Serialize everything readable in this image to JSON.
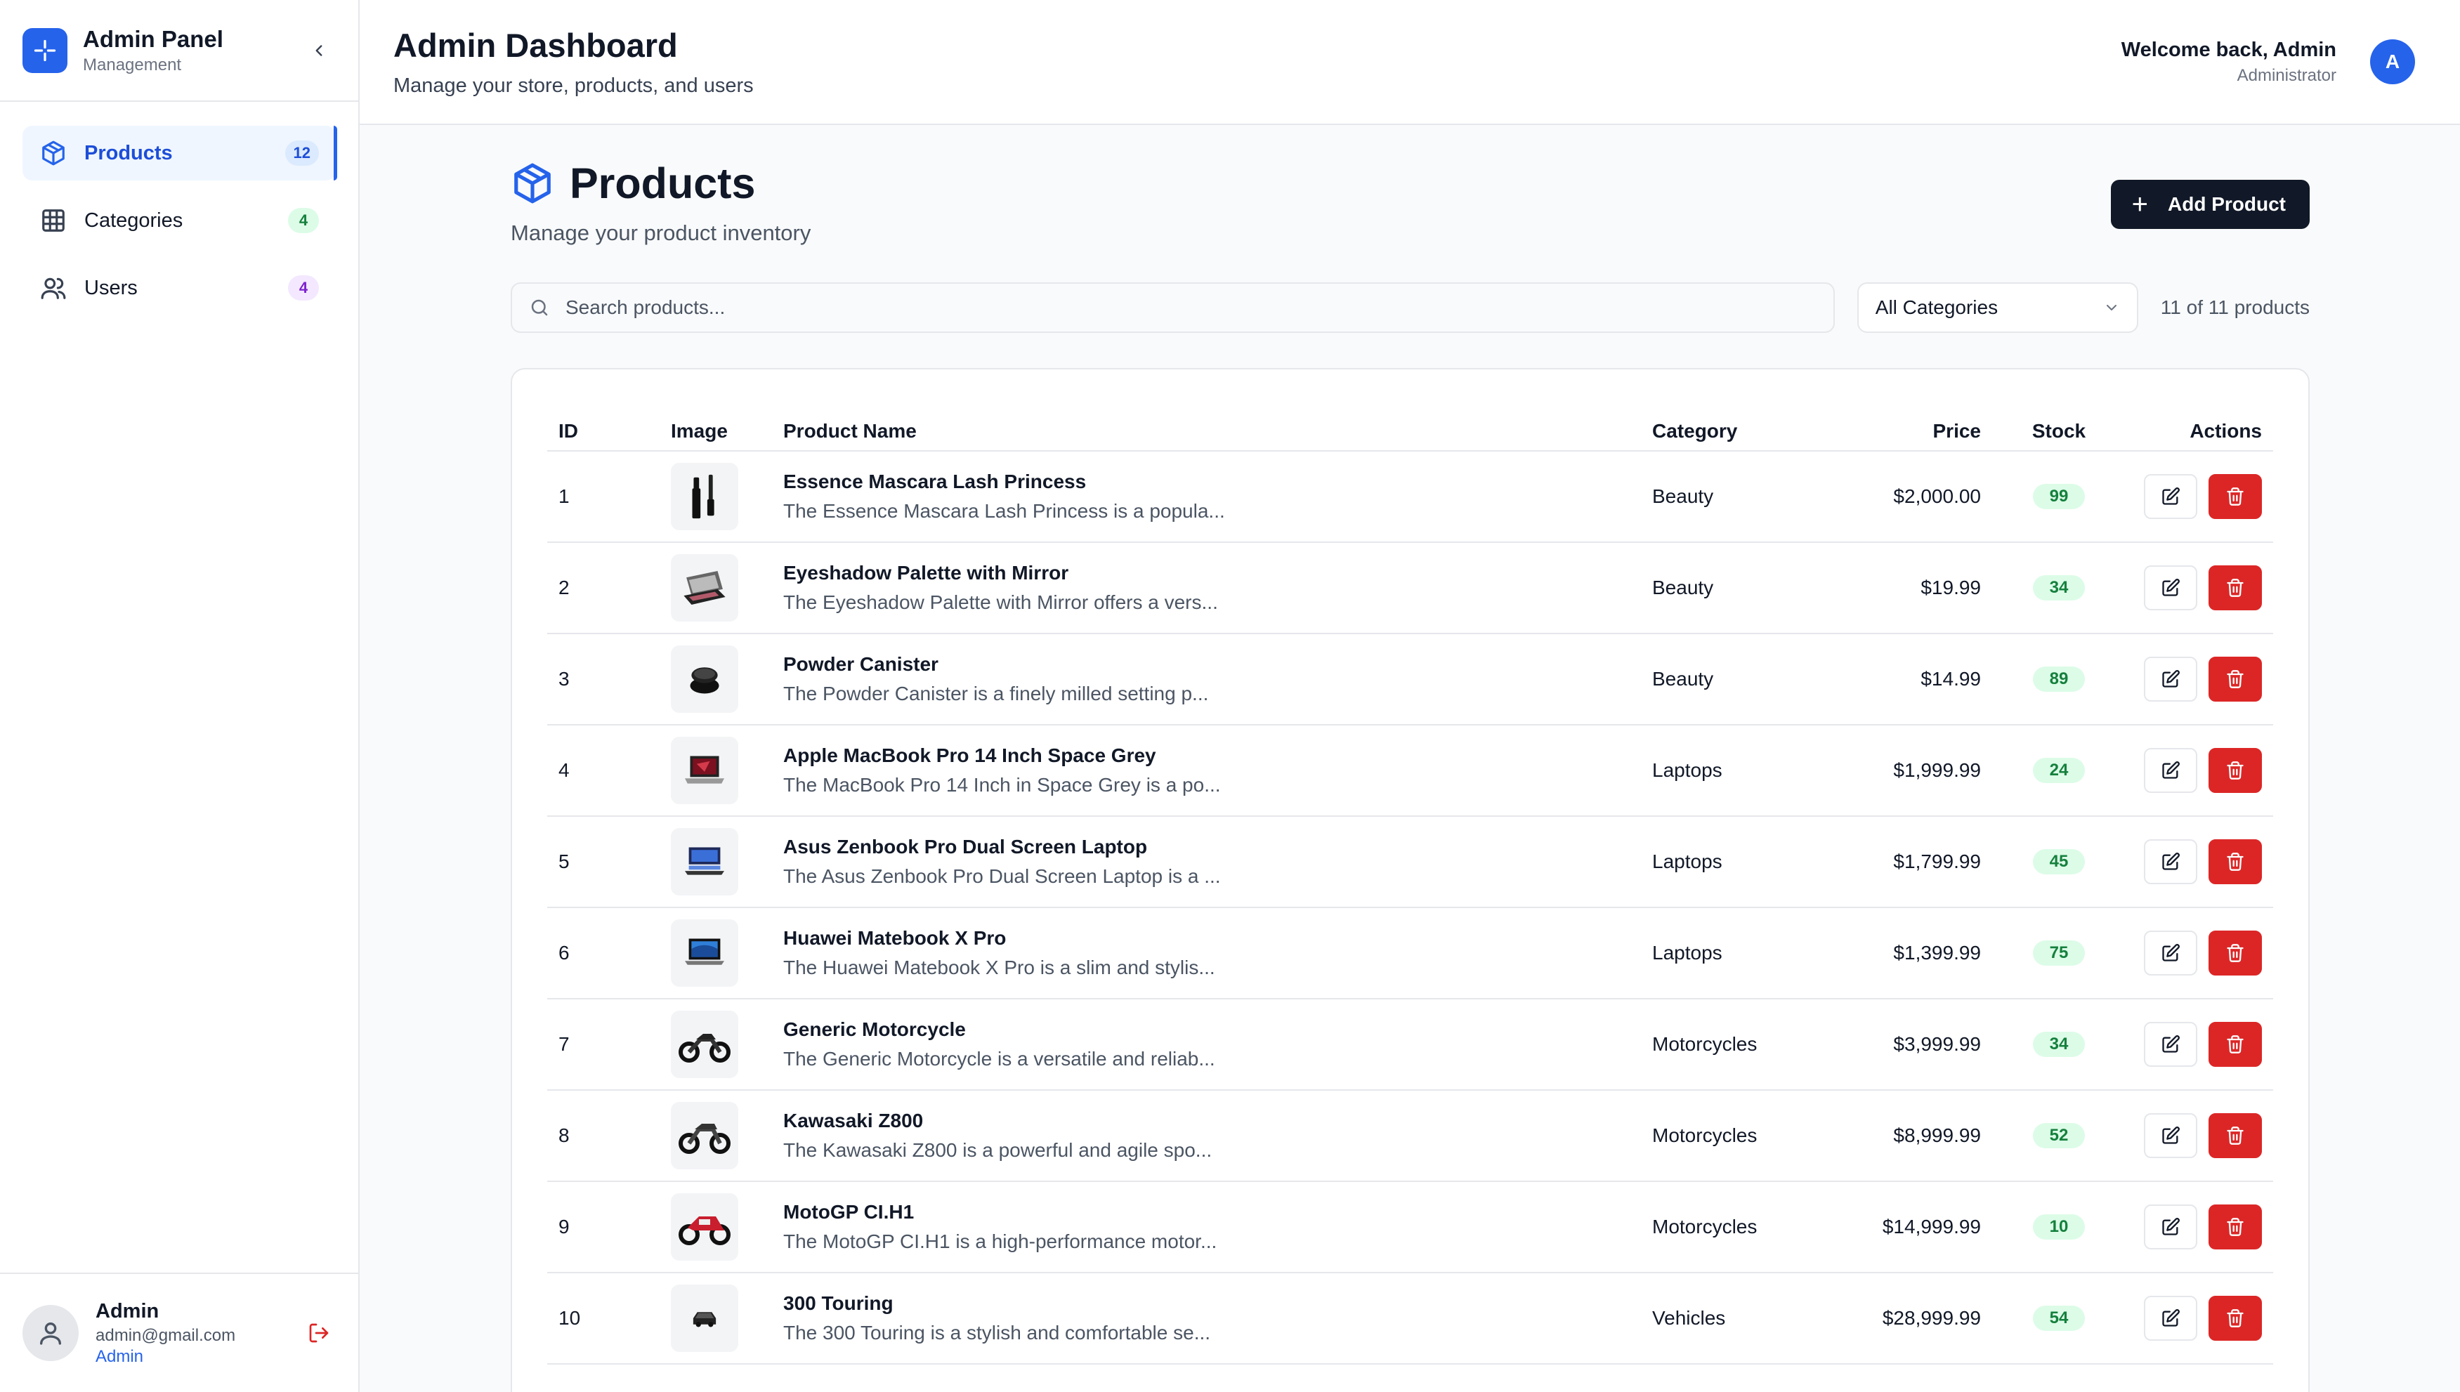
{
  "sidebar": {
    "brand_title": "Admin Panel",
    "brand_subtitle": "Management",
    "items": [
      {
        "label": "Products",
        "count": "12"
      },
      {
        "label": "Categories",
        "count": "4"
      },
      {
        "label": "Users",
        "count": "4"
      }
    ],
    "user": {
      "name": "Admin",
      "email": "admin@gmail.com",
      "role": "Admin"
    }
  },
  "header": {
    "title": "Admin Dashboard",
    "subtitle": "Manage your store, products, and users",
    "welcome": "Welcome back, Admin",
    "role": "Administrator",
    "avatar_initial": "A"
  },
  "products": {
    "title": "Products",
    "subtitle": "Manage your product inventory",
    "add_label": "Add Product",
    "search_placeholder": "Search products...",
    "category_filter": "All Categories",
    "count_text": "11 of 11 products",
    "columns": {
      "id": "ID",
      "image": "Image",
      "name": "Product Name",
      "category": "Category",
      "price": "Price",
      "stock": "Stock",
      "actions": "Actions"
    },
    "rows": [
      {
        "id": "1",
        "name": "Essence Mascara Lash Princess",
        "desc": "The Essence Mascara Lash Princess is a popula...",
        "category": "Beauty",
        "price": "$2,000.00",
        "stock": "99",
        "thumb": "mascara"
      },
      {
        "id": "2",
        "name": "Eyeshadow Palette with Mirror",
        "desc": "The Eyeshadow Palette with Mirror offers a vers...",
        "category": "Beauty",
        "price": "$19.99",
        "stock": "34",
        "thumb": "palette"
      },
      {
        "id": "3",
        "name": "Powder Canister",
        "desc": "The Powder Canister is a finely milled setting p...",
        "category": "Beauty",
        "price": "$14.99",
        "stock": "89",
        "thumb": "powder"
      },
      {
        "id": "4",
        "name": "Apple MacBook Pro 14 Inch Space Grey",
        "desc": "The MacBook Pro 14 Inch in Space Grey is a po...",
        "category": "Laptops",
        "price": "$1,999.99",
        "stock": "24",
        "thumb": "laptop-red"
      },
      {
        "id": "5",
        "name": "Asus Zenbook Pro Dual Screen Laptop",
        "desc": "The Asus Zenbook Pro Dual Screen Laptop is a ...",
        "category": "Laptops",
        "price": "$1,799.99",
        "stock": "45",
        "thumb": "laptop-blue"
      },
      {
        "id": "6",
        "name": "Huawei Matebook X Pro",
        "desc": "The Huawei Matebook X Pro is a slim and stylis...",
        "category": "Laptops",
        "price": "$1,399.99",
        "stock": "75",
        "thumb": "laptop-sky"
      },
      {
        "id": "7",
        "name": "Generic Motorcycle",
        "desc": "The Generic Motorcycle is a versatile and reliab...",
        "category": "Motorcycles",
        "price": "$3,999.99",
        "stock": "34",
        "thumb": "moto-black"
      },
      {
        "id": "8",
        "name": "Kawasaki Z800",
        "desc": "The Kawasaki Z800 is a powerful and agile spo...",
        "category": "Motorcycles",
        "price": "$8,999.99",
        "stock": "52",
        "thumb": "moto-dark"
      },
      {
        "id": "9",
        "name": "MotoGP CI.H1",
        "desc": "The MotoGP CI.H1 is a high-performance motor...",
        "category": "Motorcycles",
        "price": "$14,999.99",
        "stock": "10",
        "thumb": "moto-red"
      },
      {
        "id": "10",
        "name": "300 Touring",
        "desc": "The 300 Touring is a stylish and comfortable se...",
        "category": "Vehicles",
        "price": "$28,999.99",
        "stock": "54",
        "thumb": "car"
      }
    ]
  },
  "colors": {
    "accent": "#2563eb",
    "danger": "#dc2626",
    "dark": "#111827",
    "stock_bg": "#dcfce7",
    "stock_text": "#15803d"
  }
}
